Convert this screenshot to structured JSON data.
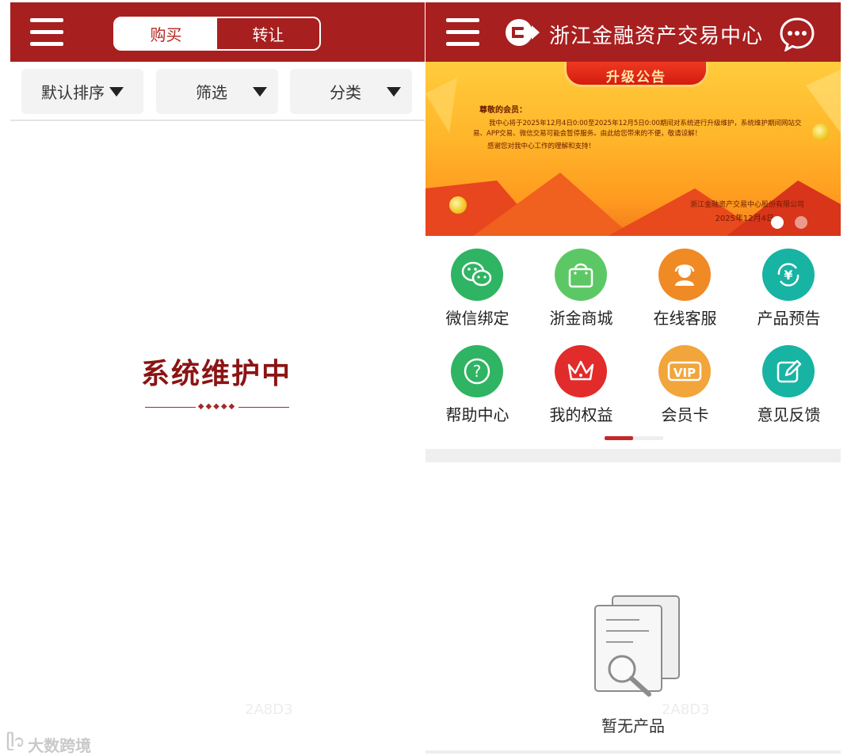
{
  "left": {
    "tabs": {
      "buy": "购买",
      "transfer": "转让"
    },
    "filters": {
      "sort": "默认排序",
      "screen": "筛选",
      "category": "分类"
    },
    "maintenance_title": "系统维护中",
    "watermark_code": "2A8D3",
    "brand_watermark": "大数跨境"
  },
  "right": {
    "header_title": "浙江金融资产交易中心",
    "banner": {
      "tag": "升级公告",
      "greeting": "尊敬的会员：",
      "body": "我中心将于2025年12月4日0:00至2025年12月5日0:00期间对系统进行升级维护，系统维护期间网站交易、APP交易、微信交易可能会暂停服务。由此给您带来的不便，敬请谅解！",
      "thanks": "感谢您对我中心工作的理解和支持！",
      "signature": "浙江金融资产交易中心股份有限公司",
      "date": "2025年12月4日"
    },
    "grid_items": [
      {
        "label": "微信绑定",
        "icon": "wechat-icon",
        "color": "#2fb463"
      },
      {
        "label": "浙金商城",
        "icon": "shopping-bag-icon",
        "color": "#5cc865"
      },
      {
        "label": "在线客服",
        "icon": "customer-service-icon",
        "color": "#f08a24"
      },
      {
        "label": "产品预告",
        "icon": "yuan-cycle-icon",
        "color": "#17b3a3"
      },
      {
        "label": "帮助中心",
        "icon": "help-icon",
        "color": "#2fb463"
      },
      {
        "label": "我的权益",
        "icon": "crown-icon",
        "color": "#e22b2b"
      },
      {
        "label": "会员卡",
        "icon": "vip-icon",
        "color": "#f2a53a"
      },
      {
        "label": "意见反馈",
        "icon": "edit-icon",
        "color": "#17b3a3"
      }
    ],
    "empty_text": "暂无产品",
    "watermark_code": "2A8D3"
  }
}
